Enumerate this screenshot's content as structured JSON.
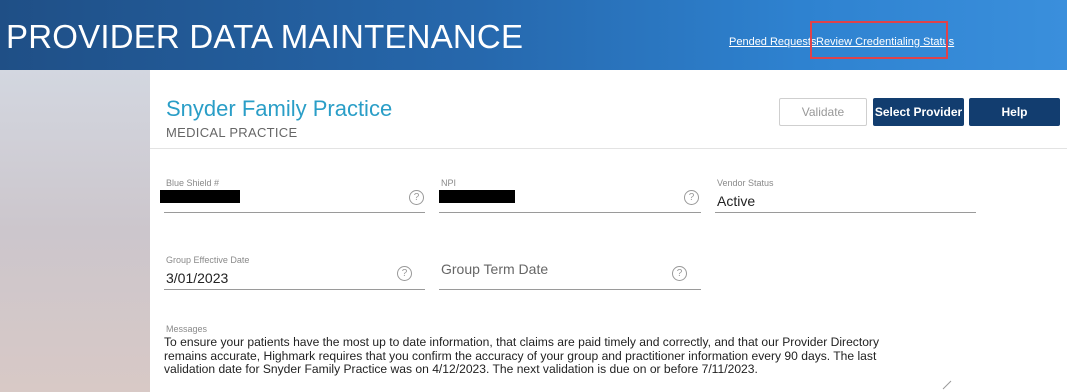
{
  "header": {
    "title": "PROVIDER DATA MAINTENANCE",
    "links": [
      {
        "label": "Pended Requests"
      },
      {
        "label": "Review Credentialing Status"
      }
    ]
  },
  "practice": {
    "name": "Snyder Family Practice",
    "type": "MEDICAL PRACTICE"
  },
  "buttons": {
    "validate": "Validate",
    "select_provider": "Select Provider",
    "help": "Help"
  },
  "fields": {
    "blue_shield": {
      "label": "Blue Shield #",
      "value": ""
    },
    "npi": {
      "label": "NPI",
      "value": ""
    },
    "vendor_status": {
      "label": "Vendor Status",
      "value": "Active"
    },
    "group_effective_date": {
      "label": "Group Effective Date",
      "value": "3/01/2023"
    },
    "group_term_date": {
      "placeholder": "Group Term Date"
    }
  },
  "help_icon_glyph": "?",
  "messages": {
    "label": "Messages",
    "lines": [
      "To ensure your patients have the most up to date information, that claims are paid timely and correctly, and that our Provider Directory",
      "remains accurate, Highmark requires that you confirm the accuracy of your group and practitioner information every 90 days.  The last",
      "validation date for Snyder Family Practice was on 4/12/2023.  The next validation is due on or before 7/11/2023."
    ]
  },
  "colors": {
    "header_start": "#1f4f86",
    "header_end": "#3a8fdc",
    "accent": "#2a9ec7",
    "button_dark": "#123d6f",
    "highlight": "#e0424a"
  }
}
